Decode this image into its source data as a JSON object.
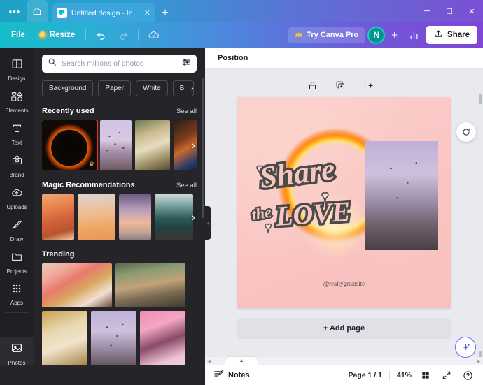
{
  "browser": {
    "menu_icon": "overflow-dots-icon",
    "home_icon": "home-icon",
    "tab": {
      "favicon": "canva-favicon",
      "title": "Untitled design - In...",
      "close_label": "✕"
    },
    "new_tab_label": "+",
    "window_controls": {
      "minimize": "─",
      "maximize": "☐",
      "close": "✕"
    }
  },
  "toolbar": {
    "file_label": "File",
    "resize_label": "Resize",
    "undo_icon": "undo-icon",
    "redo_icon": "redo-icon",
    "cloud_icon": "cloud-saved-icon",
    "pro_label": "Try Canva Pro",
    "pro_icon": "crown-icon",
    "avatar_initial": "N",
    "add_member_label": "+",
    "insights_icon": "bar-chart-icon",
    "share_label": "Share",
    "share_icon": "share-upload-icon"
  },
  "sidebar": {
    "items": [
      {
        "label": "Design",
        "icon": "design-grid-icon",
        "active": false
      },
      {
        "label": "Elements",
        "icon": "elements-shapes-icon",
        "active": false
      },
      {
        "label": "Text",
        "icon": "text-t-icon",
        "active": false
      },
      {
        "label": "Brand",
        "icon": "brand-kit-icon",
        "active": false
      },
      {
        "label": "Uploads",
        "icon": "upload-cloud-icon",
        "active": false
      },
      {
        "label": "Draw",
        "icon": "draw-pen-icon",
        "active": false
      },
      {
        "label": "Projects",
        "icon": "folder-icon",
        "active": false
      },
      {
        "label": "Apps",
        "icon": "apps-grid-icon",
        "active": false
      },
      {
        "label": "Photos",
        "icon": "photos-image-icon",
        "active": true
      }
    ]
  },
  "panel": {
    "search": {
      "placeholder": "Search millions of photos",
      "value": "",
      "search_icon": "search-icon",
      "filter_icon": "filter-sliders-icon"
    },
    "chips": [
      "Background",
      "Paper",
      "White",
      "B"
    ],
    "sections": [
      {
        "title": "Recently used",
        "link": "See all",
        "items": [
          {
            "name": "fire-ring-photo",
            "style": "ph-fire",
            "selected": true,
            "premium": true
          },
          {
            "name": "balloons-photo",
            "style": "ph-balloon",
            "selected": false,
            "premium": false
          },
          {
            "name": "woman-flowers-photo",
            "style": "ph-woman",
            "selected": false,
            "premium": false
          },
          {
            "name": "feather-photo",
            "style": "ph-feather",
            "selected": false,
            "premium": false
          }
        ]
      },
      {
        "title": "Magic Recommendations",
        "link": "See all",
        "items": [
          {
            "name": "beach-sunset-photo",
            "style": "ph-beach1",
            "selected": false,
            "premium": false
          },
          {
            "name": "desert-dunes-photo",
            "style": "ph-beach2",
            "selected": false,
            "premium": false
          },
          {
            "name": "shoreline-photo",
            "style": "ph-beach3",
            "selected": false,
            "premium": false
          },
          {
            "name": "mountain-lake-photo",
            "style": "ph-lake",
            "selected": false,
            "premium": false
          }
        ]
      },
      {
        "title": "Trending",
        "link": "",
        "wide": [
          {
            "name": "flowers-bouquet-photo",
            "style": "ph-flowers"
          },
          {
            "name": "porch-window-photo",
            "style": "ph-porch"
          }
        ],
        "tall": [
          {
            "name": "albino-model-photo",
            "style": "ph-albino"
          },
          {
            "name": "canyon-balloons-photo",
            "style": "ph-canyon"
          },
          {
            "name": "pink-fashion-photo",
            "style": "ph-pink"
          }
        ]
      }
    ],
    "crown_glyph": "♛",
    "next_arrow": "›",
    "collapse_arrow": "‹"
  },
  "editor": {
    "position_label": "Position",
    "element_actions": [
      {
        "name": "lock-icon",
        "label": "Lock"
      },
      {
        "name": "duplicate-icon",
        "label": "Duplicate"
      },
      {
        "name": "export-icon",
        "label": "Export"
      }
    ],
    "rotate_icon": "replace-rotate-icon",
    "magic_icon": "magic-sparkle-icon",
    "add_page_label": "+ Add page",
    "design": {
      "headline_line1": "Share",
      "headline_line2": "the",
      "headline_line3": "LOVE",
      "handle": "@reallygreatsite",
      "bg_color": "#fac8c5",
      "ring_color": "#ff8a10",
      "text_fill": "#f7c3bd",
      "text_outline": "#4a4a4a"
    }
  },
  "statusbar": {
    "notes_label": "Notes",
    "notes_icon": "notes-icon",
    "page_indicator": "Page 1 / 1",
    "zoom_level": "41%",
    "grid_icon": "grid-view-icon",
    "fullscreen_icon": "fullscreen-icon",
    "help_icon": "help-question-icon"
  }
}
